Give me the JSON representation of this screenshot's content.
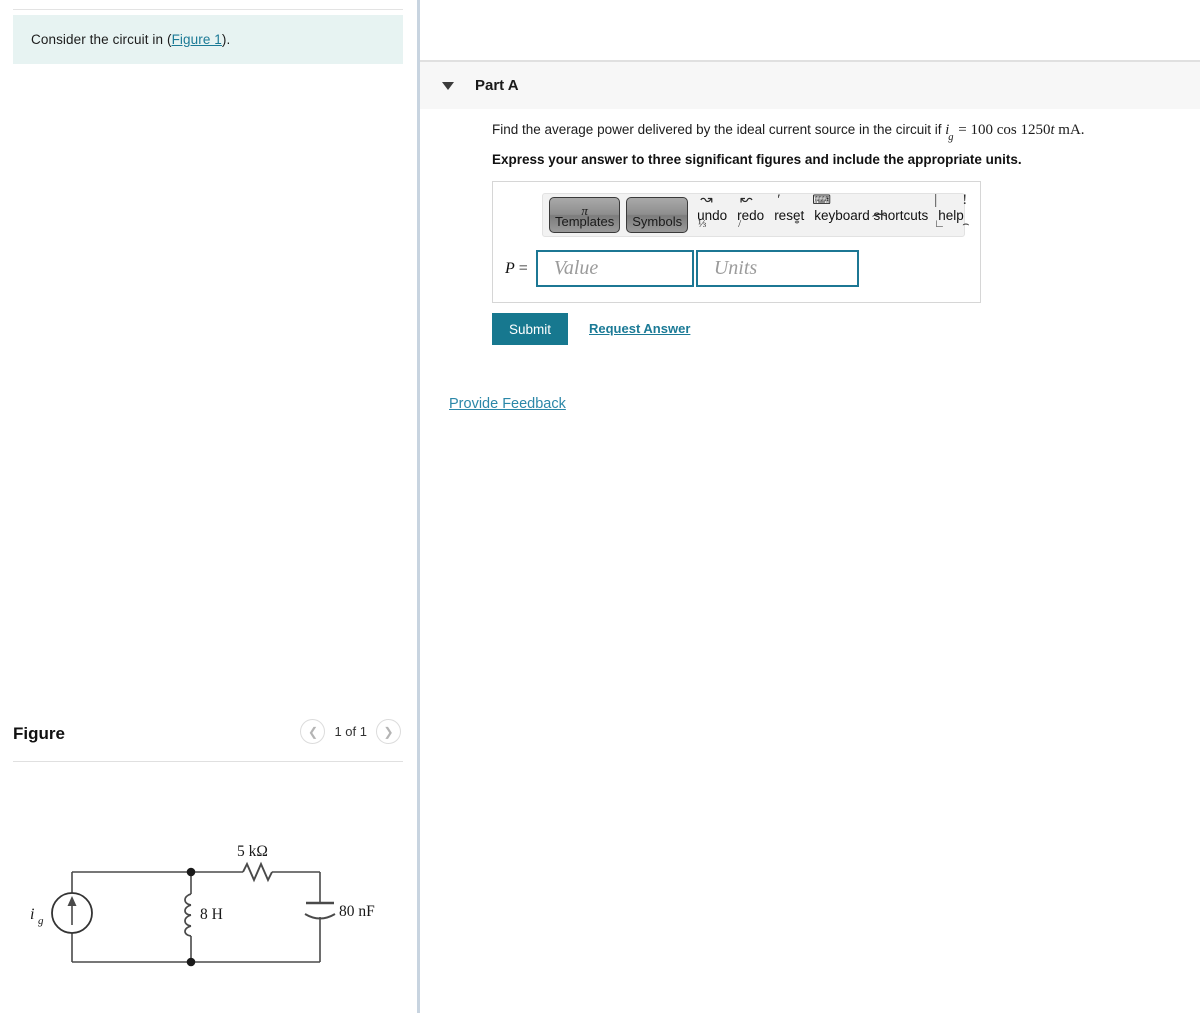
{
  "left": {
    "prompt": {
      "before": "Consider the circuit in (",
      "link": "Figure 1",
      "after": ")."
    },
    "figure": {
      "title": "Figure",
      "prev_icon": "chevron-left-icon",
      "next_icon": "chevron-right-icon",
      "counter": "1 of 1"
    },
    "circuit": {
      "source_label": "i",
      "source_sub": "g",
      "inductor_label": "8 H",
      "resistor_label": "5 kΩ",
      "capacitor_label": "80 nF"
    }
  },
  "right": {
    "part": {
      "caret_icon": "caret-down-icon",
      "label": "Part A"
    },
    "question": {
      "lead": "Find the average power delivered by the ideal current source in the circuit if ",
      "var": "i",
      "var_sub": "g",
      "eq": " = ",
      "expr": "100 cos 1250",
      "expr_var": "t",
      "expr_unit": " mA",
      "period": ".",
      "instruction": "Express your answer to three significant figures and include the appropriate units."
    },
    "toolbar": {
      "pi": "π",
      "templates": "Templates",
      "symbols": "Symbols",
      "undo": "undo",
      "redo": "redo",
      "reset": "reset",
      "keyboard_shortcuts": "keyboard shortcuts",
      "help": "help",
      "keyboard_icon": "keyboard-icon"
    },
    "answer": {
      "prefix_var": "P",
      "prefix_eq": " =",
      "value_placeholder": "Value",
      "units_placeholder": "Units"
    },
    "actions": {
      "submit": "Submit",
      "request_answer": "Request Answer",
      "provide_feedback": "Provide Feedback"
    }
  },
  "colors": {
    "teal": "#17788f",
    "link": "#1b7a96",
    "prompt_bg": "#e7f3f2",
    "header_bg": "#f7f7f7",
    "divider": "#c8d4e0"
  }
}
